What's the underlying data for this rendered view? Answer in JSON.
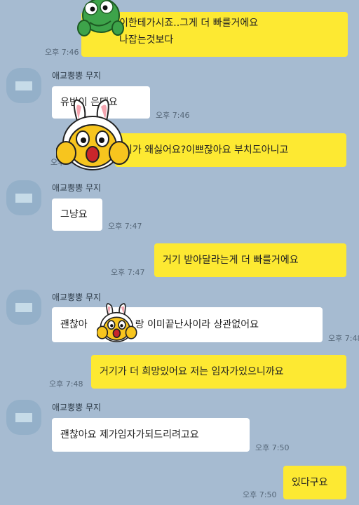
{
  "colors": {
    "background": "#a6bbd1",
    "my_bubble": "#fde932",
    "their_bubble": "#ffffff"
  },
  "contact_name": "애교뿡뿡 무지",
  "messages": [
    {
      "sender": "me",
      "lines": [
        "이한테가시죠..그게 더 빠를거에요",
        "나잡는것보다"
      ],
      "time": "오후 7:46"
    },
    {
      "sender": "them",
      "text": "유빈이 은대요",
      "time": "오후 7:46"
    },
    {
      "sender": "me",
      "text": "이가 왜싫어요?이쁘잖아요 부치도아니고",
      "time": "오후"
    },
    {
      "sender": "them",
      "text": "그냥요",
      "time": "오후 7:47"
    },
    {
      "sender": "me",
      "text": "거기 받아달라는게 더 빠를거에요",
      "time": "오후 7:47"
    },
    {
      "sender": "them",
      "text_before_sticker": "괜찮아",
      "text_after_sticker": "랑 이미끝난사이라 상관없어요",
      "time": "오후 7:48"
    },
    {
      "sender": "me",
      "text": "거기가 더 희망있어요 저는 임자가있으니까요",
      "time": "오후 7:48"
    },
    {
      "sender": "them",
      "text": "괜찮아요 제가임자가되드리려고요",
      "time": "오후 7:50"
    },
    {
      "sender": "me",
      "text": "있다구요",
      "time": "오후 7:50"
    }
  ],
  "stickers": [
    "frog-sticker",
    "muzi-sticker",
    "muzi-sticker"
  ]
}
